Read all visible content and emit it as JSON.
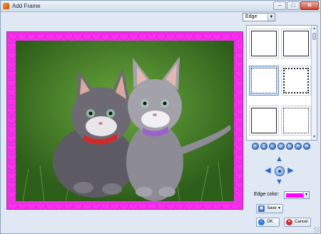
{
  "window": {
    "title": "Add Frame"
  },
  "edge": {
    "selected": "Edge"
  },
  "thumbnails": [
    {
      "style": "solid"
    },
    {
      "style": "solid"
    },
    {
      "style": "dotted",
      "selected": true
    },
    {
      "style": "dotted"
    },
    {
      "style": "solid"
    },
    {
      "style": "dotted"
    }
  ],
  "tools": [
    {
      "icon": "zoom-in-icon",
      "glyph": "+"
    },
    {
      "icon": "pin-icon",
      "glyph": "↧"
    },
    {
      "icon": "zoom-out-icon",
      "glyph": "−"
    },
    {
      "icon": "rotate-left-icon",
      "glyph": "↺"
    },
    {
      "icon": "rotate-right-icon",
      "glyph": "↻"
    },
    {
      "icon": "undo-icon",
      "glyph": "↶"
    },
    {
      "icon": "redo-icon",
      "glyph": "↷"
    }
  ],
  "edge_color": {
    "label": "Edge color:",
    "value": "#ff00ff"
  },
  "buttons": {
    "save": "Save",
    "ok": "OK",
    "cancel": "Cancel"
  },
  "colors": {
    "frame": "#ee33e6",
    "accent": "#2f68c4"
  }
}
